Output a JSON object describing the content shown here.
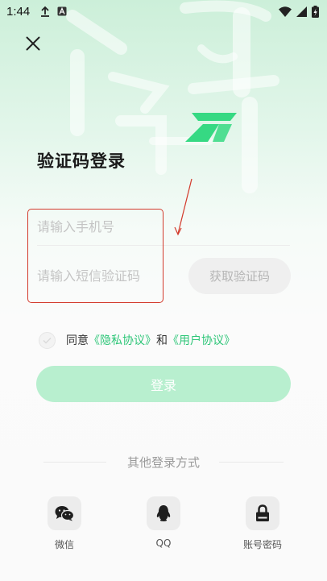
{
  "status_bar": {
    "time": "1:44"
  },
  "page": {
    "title": "验证码登录"
  },
  "form": {
    "phone_placeholder": "请输入手机号",
    "code_placeholder": "请输入短信验证码",
    "get_code_label": "获取验证码"
  },
  "agreement": {
    "prefix": "同意",
    "privacy_link": "《隐私协议》",
    "conjunction": "和",
    "user_link": "《用户协议》"
  },
  "login": {
    "label": "登录"
  },
  "other_login": {
    "title": "其他登录方式",
    "options": [
      {
        "label": "微信",
        "icon": "wechat-icon"
      },
      {
        "label": "QQ",
        "icon": "qq-penguin-icon"
      },
      {
        "label": "账号密码",
        "icon": "lock-icon"
      }
    ]
  },
  "colors": {
    "accent": "#2ec678",
    "login_button": "#b8efcf",
    "logo": "#36d983",
    "annotation": "#d33a2c"
  }
}
